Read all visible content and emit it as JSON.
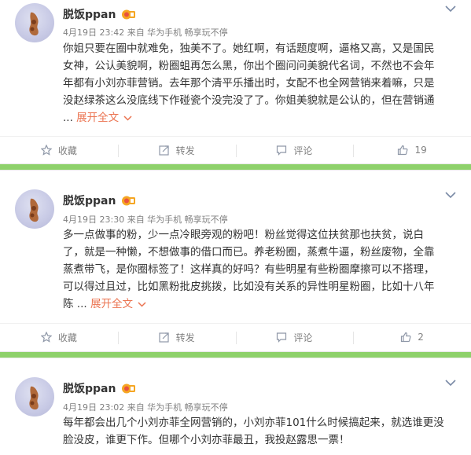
{
  "posts": [
    {
      "user_name": "脱饭ppan",
      "meta": "4月19日 23:42 来自 华为手机 畅享玩不停",
      "lines": [
        "你姐只要在圈中就难免，独美不了。她红啊，有话题度啊，逼格又高，又是国民",
        "女神，公认美貌啊，粉圈蛆再怎么黑，你出个圈问问美貌代名词，不然也不会年",
        "年都有小刘亦菲营销。去年那个清平乐播出时，女配不也全网营销来着嘛，只是",
        "没赵绿茶这么没底线下作碰瓷个没完没了了。你姐美貌就是公认的，但在营销通"
      ],
      "expand_prefix": "... ",
      "expand_label": "展开全文",
      "actions": {
        "fav": "收藏",
        "repost": "转发",
        "comment": "评论",
        "like": "19"
      }
    },
    {
      "user_name": "脱饭ppan",
      "meta": "4月19日 23:30 来自 华为手机 畅享玩不停",
      "lines": [
        "多一点做事的粉，少一点冷眼旁观的粉吧！粉丝觉得这位扶贫那也扶贫，说白",
        "了，就是一种懒，不想做事的借口而已。养老粉圈，蒸煮牛逼，粉丝废物，全靠",
        "蒸煮带飞，是你圈标签了！这样真的好吗？有些明星有些粉圈摩擦可以不搭理，",
        "可以得过且过，比如黑粉批皮挑拨，比如没有关系的异性明星粉圈，比如十八年",
        "陈"
      ],
      "expand_prefix": " ... ",
      "expand_label": "展开全文",
      "actions": {
        "fav": "收藏",
        "repost": "转发",
        "comment": "评论",
        "like": "2"
      }
    },
    {
      "user_name": "脱饭ppan",
      "meta": "4月19日 23:02 来自 华为手机 畅享玩不停",
      "lines": [
        "每年都会出几个小刘亦菲全网营销的，小刘亦菲101什么时候搞起来，就选谁更没",
        "脸没皮，谁更下作。但哪个小刘亦菲最丑，我投赵露思一票！"
      ]
    }
  ],
  "colors": {
    "separator": "#8ed16b",
    "link": "#eb7350",
    "meta": "#808080"
  }
}
